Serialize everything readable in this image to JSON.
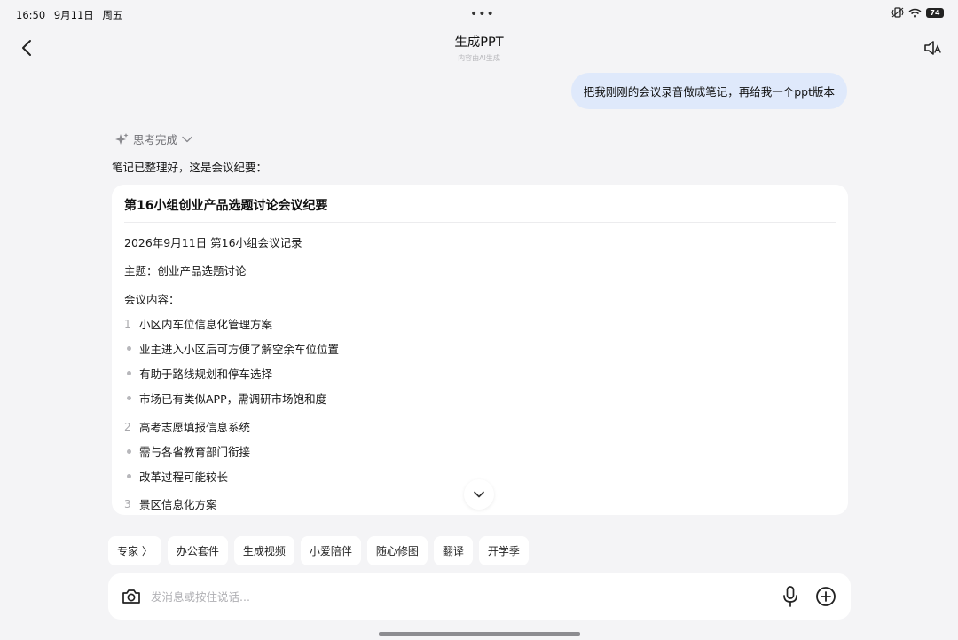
{
  "status_bar": {
    "time": "16:50",
    "date": "9月11日",
    "weekday": "周五",
    "battery": "74"
  },
  "header": {
    "title": "生成PPT",
    "subtitle": "内容由AI生成"
  },
  "conversation": {
    "user_message": "把我刚刚的会议录音做成笔记，再给我一个ppt版本",
    "thinking_label": "思考完成",
    "reply_intro": "笔记已整理好，这是会议纪要："
  },
  "note": {
    "title": "第16小组创业产品选题讨论会议纪要",
    "date_line": "2026年9月11日 第16小组会议记录",
    "topic_line": "主题：创业产品选题讨论",
    "content_label": "会议内容：",
    "items": [
      {
        "type": "number",
        "marker": "1",
        "text": "小区内车位信息化管理方案"
      },
      {
        "type": "bullet",
        "text": "业主进入小区后可方便了解空余车位位置"
      },
      {
        "type": "bullet",
        "text": "有助于路线规划和停车选择"
      },
      {
        "type": "bullet",
        "text": "市场已有类似APP，需调研市场饱和度"
      },
      {
        "type": "number",
        "marker": "2",
        "text": "高考志愿填报信息系统"
      },
      {
        "type": "bullet",
        "text": "需与各省教育部门衔接"
      },
      {
        "type": "bullet",
        "text": "改革过程可能较长"
      },
      {
        "type": "number",
        "marker": "3",
        "text": "景区信息化方案"
      }
    ]
  },
  "chips": [
    "专家 〉",
    "办公套件",
    "生成视频",
    "小爱陪伴",
    "随心修图",
    "翻译",
    "开学季"
  ],
  "input": {
    "placeholder": "发消息或按住说话..."
  },
  "icons": {
    "back": "chevron-left-icon",
    "speaker": "speaker-icon",
    "sparkle": "sparkle-icon",
    "camera": "camera-icon",
    "mic": "microphone-icon",
    "plus": "plus-circle-icon",
    "scroll_down": "chevron-down-icon"
  },
  "colors": {
    "background": "#f4f4f6",
    "user_bubble": "#dfe9fb",
    "card": "#ffffff"
  }
}
